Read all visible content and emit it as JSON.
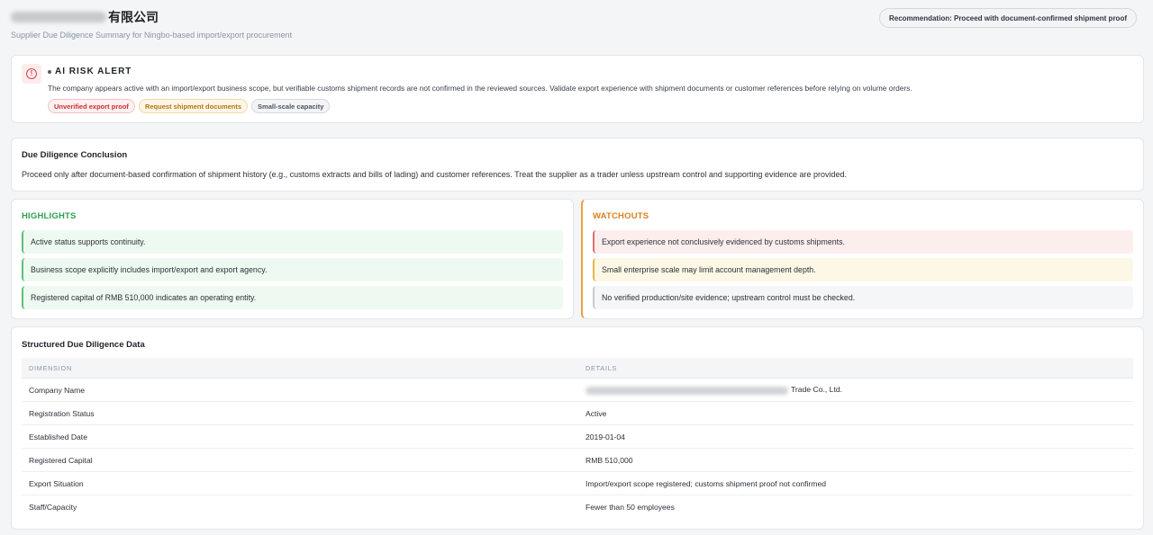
{
  "header": {
    "title_suffix": "有限公司",
    "subtitle": "Supplier Due Diligence Summary for Ningbo-based import/export procurement",
    "recommendation": "Recommendation: Proceed with document-confirmed shipment proof"
  },
  "alert": {
    "title": "AI RISK ALERT",
    "icon": "alert-circle-icon",
    "text": "The company appears active with an import/export business scope, but verifiable customs shipment records are not confirmed in the reviewed sources. Validate export experience with shipment documents or customer references before relying on volume orders.",
    "tags": [
      "Unverified export proof",
      "Request shipment documents",
      "Small-scale capacity"
    ]
  },
  "conclusion": {
    "title": "Due Diligence Conclusion",
    "text": "Proceed only after document-based confirmation of shipment history (e.g., customs extracts and bills of lading) and customer references. Treat the supplier as a trader unless upstream control and supporting evidence are provided."
  },
  "highlights": {
    "title": "HIGHLIGHTS",
    "items": [
      "Active status supports continuity.",
      "Business scope explicitly includes import/export and export agency.",
      "Registered capital of RMB 510,000 indicates an operating entity."
    ]
  },
  "watchouts": {
    "title": "WATCHOUTS",
    "items": [
      "Export experience not conclusively evidenced by customs shipments.",
      "Small enterprise scale may limit account management depth.",
      "No verified production/site evidence; upstream control must be checked."
    ]
  },
  "table": {
    "title": "Structured Due Diligence Data",
    "headers": [
      "DIMENSION",
      "DETAILS"
    ],
    "rows": [
      [
        "Company Name",
        "Trade Co., Ltd."
      ],
      [
        "Registration Status",
        "Active"
      ],
      [
        "Established Date",
        "2019-01-04"
      ],
      [
        "Registered Capital",
        "RMB 510,000"
      ],
      [
        "Export Situation",
        "Import/export scope registered; customs shipment proof not confirmed"
      ],
      [
        "Staff/Capacity",
        "Fewer than 50 employees"
      ]
    ]
  }
}
